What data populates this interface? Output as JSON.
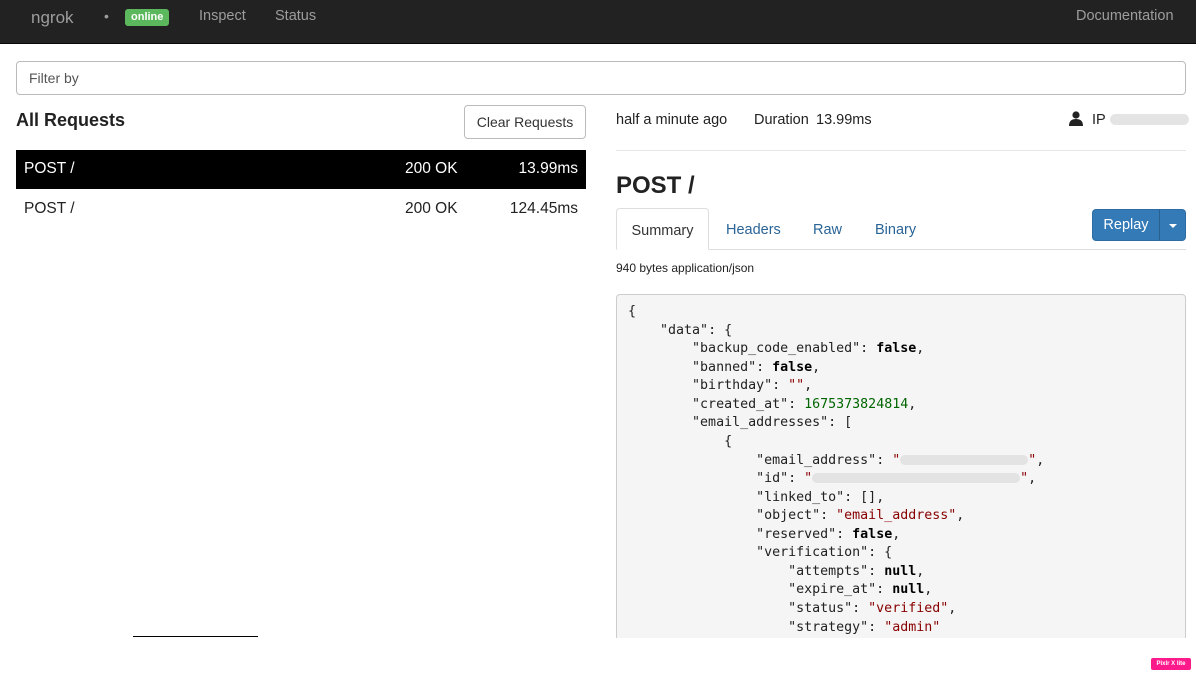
{
  "navbar": {
    "brand": "ngrok",
    "separator": "•",
    "status_badge": "online",
    "links": {
      "inspect": "Inspect",
      "status": "Status",
      "documentation": "Documentation"
    }
  },
  "filter": {
    "placeholder": "Filter by",
    "value": ""
  },
  "requests_panel": {
    "title": "All Requests",
    "clear_label": "Clear Requests",
    "rows": [
      {
        "method_path": "POST /",
        "status": "200 OK",
        "duration": "13.99ms",
        "selected": true
      },
      {
        "method_path": "POST /",
        "status": "200 OK",
        "duration": "124.45ms",
        "selected": false
      }
    ]
  },
  "detail": {
    "time_ago": "half a minute ago",
    "duration_label": "Duration",
    "duration_value": "13.99ms",
    "ip_label": "IP",
    "title": "POST /",
    "tabs": [
      "Summary",
      "Headers",
      "Raw",
      "Binary"
    ],
    "active_tab": "Summary",
    "replay_label": "Replay",
    "body_info": "940 bytes application/json",
    "json": {
      "open_brace": "{",
      "data_key": "\"data\"",
      "backup_code_enabled_key": "\"backup_code_enabled\"",
      "backup_code_enabled": "false",
      "banned_key": "\"banned\"",
      "banned": "false",
      "birthday_key": "\"birthday\"",
      "birthday": "\"\"",
      "created_at_key": "\"created_at\"",
      "created_at": "1675373824814",
      "email_addresses_key": "\"email_addresses\"",
      "email_address_key": "\"email_address\"",
      "id_key": "\"id\"",
      "linked_to_key": "\"linked_to\"",
      "linked_to": "[]",
      "object_key": "\"object\"",
      "object": "\"email_address\"",
      "reserved_key": "\"reserved\"",
      "reserved": "false",
      "verification_key": "\"verification\"",
      "attempts_key": "\"attempts\"",
      "attempts": "null",
      "expire_at_key": "\"expire_at\"",
      "expire_at": "null",
      "status_key": "\"status\"",
      "status": "\"verified\"",
      "strategy_key": "\"strategy\"",
      "strategy": "\"admin\""
    }
  },
  "watermark": "Pixlr X lite",
  "colors": {
    "navbar_bg": "#222222",
    "online_badge": "#5cb85c",
    "replay_button": "#337ab7",
    "selected_row_bg": "#000000",
    "json_string": "#880000",
    "json_number": "#006600"
  }
}
